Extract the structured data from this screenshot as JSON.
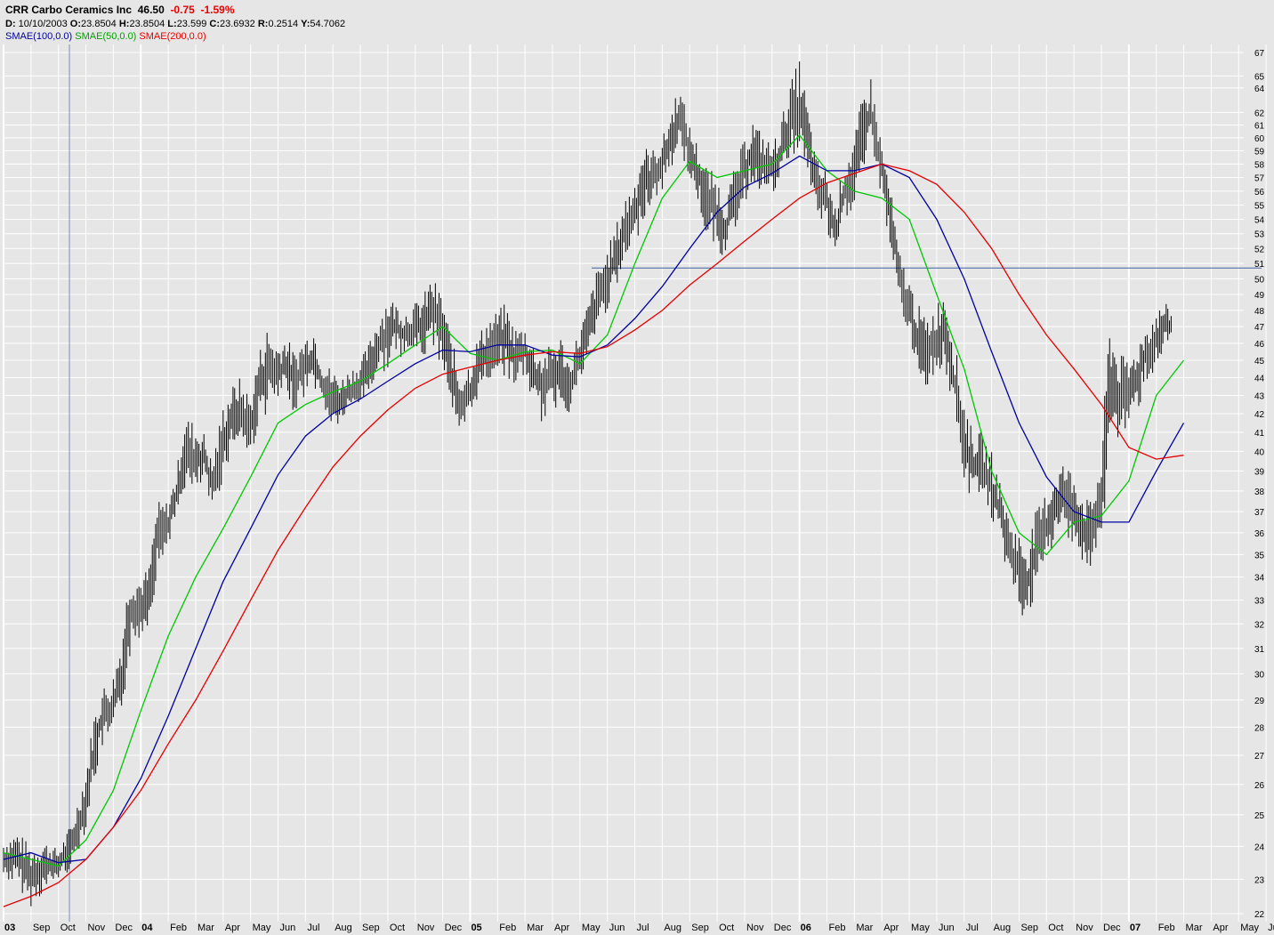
{
  "header": {
    "symbol": "CRR",
    "company": "Carbo Ceramics Inc",
    "last": "46.50",
    "change": "-0.75",
    "change_pct": "-1.59%",
    "d_label": "D:",
    "date": "10/10/2003",
    "o_label": "O:",
    "open": "23.8504",
    "h_label": "H:",
    "high": "23.8504",
    "l_label": "L:",
    "low": "23.599",
    "c_label": "C:",
    "close": "23.6932",
    "r_label": "R:",
    "range": "0.2514",
    "y_label": "Y:",
    "y": "54.7062",
    "ind1": "SMAE(100,0.0)",
    "ind2": "SMAE(50,0.0)",
    "ind3": "SMAE(200,0.0)"
  },
  "colors": {
    "background": "#e6e6e6",
    "grid": "#ffffff",
    "price": "#000000",
    "sma100": "#0000a0",
    "sma50": "#00c800",
    "sma200": "#e60000",
    "crosshair": "#4060a0",
    "cursor_line": "#7f8fb0"
  },
  "chart_data": {
    "type": "line",
    "y_scale": "log",
    "y_ticks": [
      22,
      23,
      24,
      25,
      26,
      27,
      28,
      29,
      30,
      31,
      32,
      33,
      34,
      35,
      36,
      37,
      38,
      39,
      40,
      41,
      42,
      43,
      44,
      45,
      46,
      47,
      48,
      49,
      50,
      51,
      52,
      53,
      54,
      55,
      56,
      57,
      58,
      59,
      60,
      61,
      62,
      64,
      65,
      67
    ],
    "x_month_labels": [
      {
        "t": 0,
        "label": "03",
        "year": true
      },
      {
        "t": 1,
        "label": "Sep"
      },
      {
        "t": 2,
        "label": "Oct"
      },
      {
        "t": 3,
        "label": "Nov"
      },
      {
        "t": 4,
        "label": "Dec"
      },
      {
        "t": 5,
        "label": "04",
        "year": true
      },
      {
        "t": 6,
        "label": "Feb"
      },
      {
        "t": 7,
        "label": "Mar"
      },
      {
        "t": 8,
        "label": "Apr"
      },
      {
        "t": 9,
        "label": "May"
      },
      {
        "t": 10,
        "label": "Jun"
      },
      {
        "t": 11,
        "label": "Jul"
      },
      {
        "t": 12,
        "label": "Aug"
      },
      {
        "t": 13,
        "label": "Sep"
      },
      {
        "t": 14,
        "label": "Oct"
      },
      {
        "t": 15,
        "label": "Nov"
      },
      {
        "t": 16,
        "label": "Dec"
      },
      {
        "t": 17,
        "label": "05",
        "year": true
      },
      {
        "t": 18,
        "label": "Feb"
      },
      {
        "t": 19,
        "label": "Mar"
      },
      {
        "t": 20,
        "label": "Apr"
      },
      {
        "t": 21,
        "label": "May"
      },
      {
        "t": 22,
        "label": "Jun"
      },
      {
        "t": 23,
        "label": "Jul"
      },
      {
        "t": 24,
        "label": "Aug"
      },
      {
        "t": 25,
        "label": "Sep"
      },
      {
        "t": 26,
        "label": "Oct"
      },
      {
        "t": 27,
        "label": "Nov"
      },
      {
        "t": 28,
        "label": "Dec"
      },
      {
        "t": 29,
        "label": "06",
        "year": true
      },
      {
        "t": 30,
        "label": "Feb"
      },
      {
        "t": 31,
        "label": "Mar"
      },
      {
        "t": 32,
        "label": "Apr"
      },
      {
        "t": 33,
        "label": "May"
      },
      {
        "t": 34,
        "label": "Jun"
      },
      {
        "t": 35,
        "label": "Jul"
      },
      {
        "t": 36,
        "label": "Aug"
      },
      {
        "t": 37,
        "label": "Sep"
      },
      {
        "t": 38,
        "label": "Oct"
      },
      {
        "t": 39,
        "label": "Nov"
      },
      {
        "t": 40,
        "label": "Dec"
      },
      {
        "t": 41,
        "label": "07",
        "year": true
      },
      {
        "t": 42,
        "label": "Feb"
      },
      {
        "t": 43,
        "label": "Mar"
      },
      {
        "t": 44,
        "label": "Apr"
      },
      {
        "t": 45,
        "label": "May"
      },
      {
        "t": 46,
        "label": "Jun"
      }
    ],
    "price_high_low": [
      [
        0,
        23.0,
        24.2
      ],
      [
        0.5,
        22.8,
        24.5
      ],
      [
        1,
        22.2,
        24.0
      ],
      [
        1.5,
        22.6,
        24.2
      ],
      [
        2,
        23.0,
        23.9
      ],
      [
        2.5,
        23.3,
        24.8
      ],
      [
        3,
        24.5,
        26.5
      ],
      [
        3.3,
        26.0,
        28.5
      ],
      [
        3.6,
        27.2,
        29.5
      ],
      [
        4,
        27.5,
        30.0
      ],
      [
        4.3,
        28.5,
        31.5
      ],
      [
        4.6,
        30.5,
        34.5
      ],
      [
        5,
        31.5,
        34.0
      ],
      [
        5.3,
        32.0,
        34.5
      ],
      [
        5.6,
        34.0,
        37.5
      ],
      [
        6,
        35.5,
        37.5
      ],
      [
        6.3,
        36.5,
        39.0
      ],
      [
        6.6,
        38.0,
        42.0
      ],
      [
        7,
        37.5,
        41.5
      ],
      [
        7.3,
        38.5,
        41.0
      ],
      [
        7.6,
        36.8,
        39.5
      ],
      [
        8,
        38.5,
        42.5
      ],
      [
        8.3,
        40.0,
        43.5
      ],
      [
        8.6,
        40.5,
        44.0
      ],
      [
        9,
        39.5,
        43.0
      ],
      [
        9.3,
        41.5,
        45.5
      ],
      [
        9.6,
        42.0,
        47.0
      ],
      [
        10,
        42.5,
        46.0
      ],
      [
        10.3,
        43.0,
        46.5
      ],
      [
        10.6,
        42.0,
        45.5
      ],
      [
        11,
        43.0,
        46.5
      ],
      [
        11.3,
        43.5,
        47.0
      ],
      [
        11.6,
        42.5,
        45.0
      ],
      [
        12,
        41.0,
        44.5
      ],
      [
        12.3,
        41.5,
        44.0
      ],
      [
        12.6,
        42.0,
        44.5
      ],
      [
        13,
        42.5,
        45.0
      ],
      [
        13.3,
        43.0,
        46.0
      ],
      [
        13.6,
        44.0,
        47.5
      ],
      [
        14,
        44.5,
        49.0
      ],
      [
        14.3,
        45.5,
        48.5
      ],
      [
        14.6,
        45.0,
        48.0
      ],
      [
        15,
        45.5,
        48.5
      ],
      [
        15.3,
        45.0,
        49.0
      ],
      [
        15.6,
        46.0,
        50.2
      ],
      [
        16,
        44.5,
        49.0
      ],
      [
        16.3,
        42.5,
        46.5
      ],
      [
        16.6,
        40.0,
        44.5
      ],
      [
        17,
        41.5,
        45.0
      ],
      [
        17.3,
        43.0,
        46.5
      ],
      [
        17.6,
        43.5,
        47.5
      ],
      [
        18,
        44.5,
        48.0
      ],
      [
        18.3,
        44.0,
        48.5
      ],
      [
        18.6,
        43.5,
        47.0
      ],
      [
        19,
        44.0,
        47.0
      ],
      [
        19.3,
        42.5,
        46.0
      ],
      [
        19.6,
        41.5,
        45.5
      ],
      [
        20,
        42.0,
        46.0
      ],
      [
        20.3,
        42.5,
        46.5
      ],
      [
        20.6,
        42.0,
        45.0
      ],
      [
        21,
        43.5,
        47.0
      ],
      [
        21.3,
        45.0,
        48.5
      ],
      [
        21.6,
        46.5,
        50.5
      ],
      [
        22,
        48.0,
        52.0
      ],
      [
        22.3,
        49.0,
        53.5
      ],
      [
        22.6,
        50.5,
        55.5
      ],
      [
        23,
        52.0,
        57.0
      ],
      [
        23.3,
        54.0,
        59.5
      ],
      [
        23.6,
        55.0,
        59.0
      ],
      [
        24,
        56.0,
        60.0
      ],
      [
        24.3,
        57.5,
        62.0
      ],
      [
        24.6,
        59.0,
        64.5
      ],
      [
        25,
        57.0,
        61.0
      ],
      [
        25.3,
        55.0,
        59.5
      ],
      [
        25.6,
        53.0,
        58.0
      ],
      [
        26,
        52.0,
        57.0
      ],
      [
        26.3,
        51.0,
        55.5
      ],
      [
        26.6,
        53.0,
        57.5
      ],
      [
        27,
        55.0,
        60.0
      ],
      [
        27.3,
        56.5,
        61.5
      ],
      [
        27.6,
        56.0,
        60.5
      ],
      [
        28,
        55.5,
        59.5
      ],
      [
        28.3,
        56.5,
        61.0
      ],
      [
        28.6,
        58.0,
        64.0
      ],
      [
        29,
        59.0,
        66.5
      ],
      [
        29.3,
        57.0,
        62.5
      ],
      [
        29.6,
        54.5,
        58.5
      ],
      [
        30,
        53.0,
        57.5
      ],
      [
        30.3,
        51.0,
        55.0
      ],
      [
        30.6,
        53.5,
        58.0
      ],
      [
        31,
        55.0,
        60.0
      ],
      [
        31.3,
        57.0,
        63.5
      ],
      [
        31.6,
        59.0,
        65.0
      ],
      [
        32,
        55.5,
        59.5
      ],
      [
        32.3,
        52.0,
        56.5
      ],
      [
        32.6,
        49.0,
        52.0
      ],
      [
        33,
        46.0,
        50.0
      ],
      [
        33.3,
        44.0,
        48.5
      ],
      [
        33.6,
        43.5,
        47.5
      ],
      [
        34,
        44.0,
        48.5
      ],
      [
        34.3,
        44.5,
        49.5
      ],
      [
        34.6,
        42.0,
        46.5
      ],
      [
        35,
        38.0,
        43.0
      ],
      [
        35.3,
        37.5,
        41.0
      ],
      [
        35.6,
        38.0,
        41.0
      ],
      [
        36,
        36.5,
        40.0
      ],
      [
        36.3,
        35.5,
        38.5
      ],
      [
        36.6,
        34.0,
        37.0
      ],
      [
        37,
        32.5,
        36.0
      ],
      [
        37.3,
        32.0,
        35.5
      ],
      [
        37.6,
        33.0,
        37.0
      ],
      [
        38,
        34.5,
        38.0
      ],
      [
        38.3,
        35.5,
        39.0
      ],
      [
        38.6,
        36.0,
        39.5
      ],
      [
        39,
        35.5,
        39.0
      ],
      [
        39.3,
        34.5,
        38.0
      ],
      [
        39.6,
        34.0,
        37.5
      ],
      [
        40,
        35.0,
        40.0
      ],
      [
        40.3,
        40.0,
        47.5
      ],
      [
        40.6,
        40.5,
        45.5
      ],
      [
        41,
        41.0,
        45.0
      ],
      [
        41.3,
        42.0,
        46.0
      ],
      [
        41.6,
        43.5,
        47.0
      ],
      [
        42,
        44.5,
        48.0
      ],
      [
        42.3,
        45.5,
        48.5
      ],
      [
        42.6,
        46.0,
        48.0
      ]
    ],
    "series": [
      {
        "name": "SMAE(50,0.0)",
        "color": "#00c800",
        "points": [
          [
            0,
            23.8
          ],
          [
            1,
            23.6
          ],
          [
            2,
            23.4
          ],
          [
            3,
            24.2
          ],
          [
            4,
            25.8
          ],
          [
            5,
            28.6
          ],
          [
            6,
            31.5
          ],
          [
            7,
            34.0
          ],
          [
            8,
            36.2
          ],
          [
            9,
            38.7
          ],
          [
            10,
            41.5
          ],
          [
            11,
            42.5
          ],
          [
            12,
            43.2
          ],
          [
            13,
            43.8
          ],
          [
            14,
            44.8
          ],
          [
            15,
            45.9
          ],
          [
            16,
            47.0
          ],
          [
            17,
            45.4
          ],
          [
            18,
            45.0
          ],
          [
            19,
            45.5
          ],
          [
            20,
            45.6
          ],
          [
            21,
            44.8
          ],
          [
            22,
            46.5
          ],
          [
            23,
            51.0
          ],
          [
            24,
            55.5
          ],
          [
            25,
            58.2
          ],
          [
            26,
            57.0
          ],
          [
            27,
            57.5
          ],
          [
            28,
            58.0
          ],
          [
            29,
            60.2
          ],
          [
            30,
            57.5
          ],
          [
            31,
            56.0
          ],
          [
            32,
            55.5
          ],
          [
            33,
            54.0
          ],
          [
            34,
            49.0
          ],
          [
            35,
            44.5
          ],
          [
            36,
            39.0
          ],
          [
            37,
            36.0
          ],
          [
            38,
            35.0
          ],
          [
            39,
            36.5
          ],
          [
            40,
            36.8
          ],
          [
            41,
            38.5
          ],
          [
            42,
            43.0
          ],
          [
            43,
            45.0
          ]
        ]
      },
      {
        "name": "SMAE(100,0.0)",
        "color": "#0000a0",
        "points": [
          [
            0,
            23.6
          ],
          [
            1,
            23.8
          ],
          [
            2,
            23.5
          ],
          [
            3,
            23.6
          ],
          [
            4,
            24.6
          ],
          [
            5,
            26.2
          ],
          [
            6,
            28.4
          ],
          [
            7,
            31.0
          ],
          [
            8,
            33.8
          ],
          [
            9,
            36.2
          ],
          [
            10,
            38.8
          ],
          [
            11,
            40.8
          ],
          [
            12,
            42.0
          ],
          [
            13,
            42.8
          ],
          [
            14,
            43.8
          ],
          [
            15,
            44.8
          ],
          [
            16,
            45.6
          ],
          [
            17,
            45.5
          ],
          [
            18,
            45.9
          ],
          [
            19,
            45.9
          ],
          [
            20,
            45.3
          ],
          [
            21,
            45.2
          ],
          [
            22,
            45.9
          ],
          [
            23,
            47.5
          ],
          [
            24,
            49.5
          ],
          [
            25,
            52.0
          ],
          [
            26,
            54.5
          ],
          [
            27,
            56.3
          ],
          [
            28,
            57.3
          ],
          [
            29,
            58.6
          ],
          [
            30,
            57.5
          ],
          [
            31,
            57.5
          ],
          [
            32,
            58.0
          ],
          [
            33,
            57.0
          ],
          [
            34,
            54.0
          ],
          [
            35,
            50.0
          ],
          [
            36,
            45.5
          ],
          [
            37,
            41.5
          ],
          [
            38,
            38.7
          ],
          [
            39,
            37.0
          ],
          [
            40,
            36.5
          ],
          [
            41,
            36.5
          ],
          [
            42,
            39.0
          ],
          [
            43,
            41.5
          ]
        ]
      },
      {
        "name": "SMAE(200,0.0)",
        "color": "#e60000",
        "points": [
          [
            0,
            22.2
          ],
          [
            1,
            22.5
          ],
          [
            2,
            22.9
          ],
          [
            3,
            23.6
          ],
          [
            4,
            24.6
          ],
          [
            5,
            25.8
          ],
          [
            6,
            27.4
          ],
          [
            7,
            29.0
          ],
          [
            8,
            30.9
          ],
          [
            9,
            33.0
          ],
          [
            10,
            35.2
          ],
          [
            11,
            37.2
          ],
          [
            12,
            39.2
          ],
          [
            13,
            40.8
          ],
          [
            14,
            42.2
          ],
          [
            15,
            43.4
          ],
          [
            16,
            44.2
          ],
          [
            17,
            44.6
          ],
          [
            18,
            45.0
          ],
          [
            19,
            45.3
          ],
          [
            20,
            45.5
          ],
          [
            21,
            45.4
          ],
          [
            22,
            45.8
          ],
          [
            23,
            46.8
          ],
          [
            24,
            48.0
          ],
          [
            25,
            49.6
          ],
          [
            26,
            51.0
          ],
          [
            27,
            52.5
          ],
          [
            28,
            54.0
          ],
          [
            29,
            55.5
          ],
          [
            30,
            56.6
          ],
          [
            31,
            57.3
          ],
          [
            32,
            58.0
          ],
          [
            33,
            57.5
          ],
          [
            34,
            56.5
          ],
          [
            35,
            54.5
          ],
          [
            36,
            52.0
          ],
          [
            37,
            49.0
          ],
          [
            38,
            46.5
          ],
          [
            39,
            44.5
          ],
          [
            40,
            42.5
          ],
          [
            41,
            40.2
          ],
          [
            42,
            39.6
          ],
          [
            43,
            39.8
          ]
        ]
      }
    ],
    "horizontal_line": 50.7,
    "crosshair_t": 2.4
  }
}
